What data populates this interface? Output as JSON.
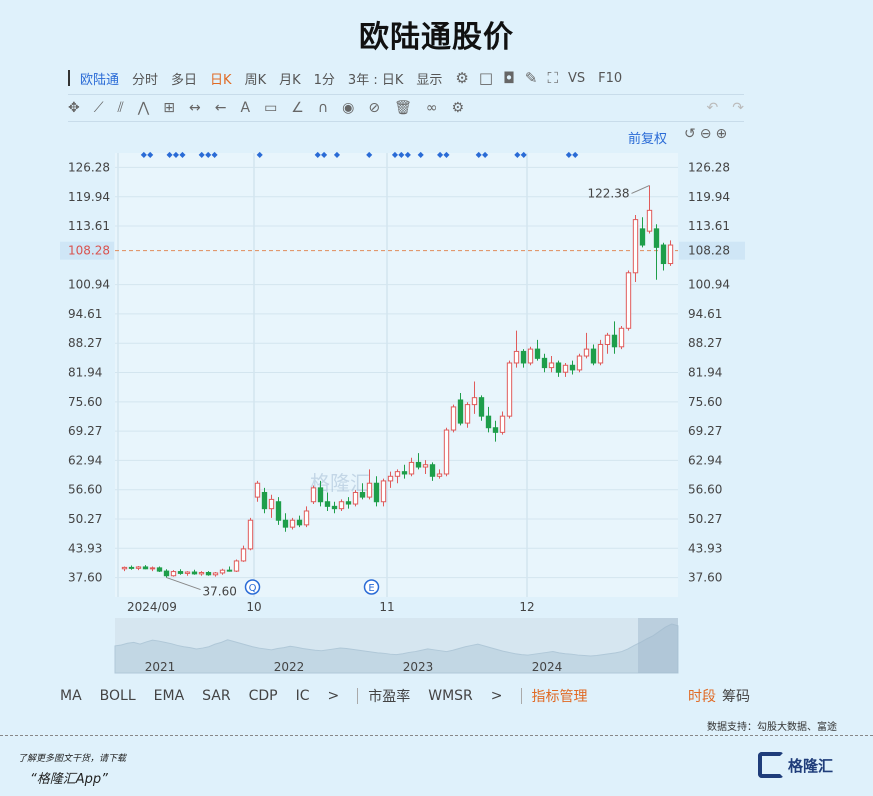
{
  "page": {
    "title": "欧陆通股价"
  },
  "toolbar": {
    "stock_name": "欧陆通",
    "periods": [
      "分时",
      "多日",
      "日K",
      "周K",
      "月K",
      "1分"
    ],
    "active_period": "日K",
    "range": "3年 : 日K",
    "display": "显示",
    "vs": "VS",
    "f10": "F10"
  },
  "adjust_label": "前复权",
  "chart_data": {
    "type": "candlestick",
    "title": "欧陆通股价",
    "y_ticks": [
      126.28,
      119.94,
      113.61,
      108.28,
      100.94,
      94.61,
      88.27,
      81.94,
      75.6,
      69.27,
      62.94,
      56.6,
      50.27,
      43.93,
      37.6
    ],
    "y_tick_labels": [
      "126.28",
      "119.94",
      "113.61",
      "108.28",
      "100.94",
      "94.61",
      "88.27",
      "81.94",
      "75.60",
      "69.27",
      "62.94",
      "56.60",
      "50.27",
      "43.93",
      "37.60"
    ],
    "ylim": [
      33.4,
      129.4
    ],
    "current_price": 108.28,
    "current_price_label": "108.28",
    "max_label": "122.38",
    "min_label": "37.60",
    "x_labels": [
      "2024/09",
      "10",
      "11",
      "12"
    ],
    "event_markers": [
      "Q",
      "E"
    ],
    "candles": [
      [
        39.5,
        40.0,
        39.0,
        39.8
      ],
      [
        39.8,
        40.2,
        39.3,
        39.6
      ],
      [
        39.6,
        40.1,
        39.2,
        39.9
      ],
      [
        39.9,
        40.3,
        39.4,
        39.5
      ],
      [
        39.5,
        40.0,
        39.0,
        39.7
      ],
      [
        39.7,
        40.0,
        38.8,
        39.0
      ],
      [
        39.0,
        39.4,
        37.6,
        38.0
      ],
      [
        38.0,
        39.2,
        37.8,
        38.9
      ],
      [
        38.9,
        39.4,
        38.2,
        38.5
      ],
      [
        38.5,
        39.0,
        38.0,
        38.8
      ],
      [
        38.8,
        39.3,
        38.2,
        38.4
      ],
      [
        38.4,
        39.0,
        38.0,
        38.7
      ],
      [
        38.7,
        39.0,
        38.0,
        38.2
      ],
      [
        38.2,
        38.8,
        37.8,
        38.6
      ],
      [
        38.6,
        39.5,
        38.2,
        39.2
      ],
      [
        39.2,
        40.0,
        38.9,
        39.0
      ],
      [
        39.0,
        41.5,
        38.8,
        41.2
      ],
      [
        41.2,
        44.5,
        41.0,
        43.8
      ],
      [
        43.8,
        50.5,
        43.5,
        50.0
      ],
      [
        55.0,
        58.5,
        54.0,
        58.0
      ],
      [
        56.0,
        57.0,
        51.5,
        52.5
      ],
      [
        52.5,
        55.5,
        50.5,
        54.5
      ],
      [
        54.0,
        55.0,
        49.0,
        50.0
      ],
      [
        50.0,
        51.5,
        47.5,
        48.5
      ],
      [
        48.5,
        50.5,
        48.0,
        50.0
      ],
      [
        50.0,
        51.0,
        48.5,
        49.0
      ],
      [
        49.0,
        53.0,
        48.5,
        52.0
      ],
      [
        54.0,
        57.5,
        53.5,
        57.0
      ],
      [
        57.0,
        58.5,
        53.0,
        54.0
      ],
      [
        54.0,
        56.0,
        52.0,
        53.0
      ],
      [
        53.0,
        54.0,
        51.5,
        52.5
      ],
      [
        52.5,
        54.5,
        52.0,
        54.0
      ],
      [
        54.0,
        55.0,
        52.5,
        53.5
      ],
      [
        53.5,
        56.5,
        53.0,
        56.0
      ],
      [
        56.0,
        58.0,
        54.5,
        55.0
      ],
      [
        55.0,
        61.0,
        54.5,
        58.0
      ],
      [
        58.0,
        59.5,
        53.0,
        54.0
      ],
      [
        54.0,
        59.0,
        53.0,
        58.5
      ],
      [
        58.5,
        60.5,
        57.0,
        59.5
      ],
      [
        59.5,
        61.0,
        58.0,
        60.5
      ],
      [
        60.5,
        62.0,
        59.0,
        60.0
      ],
      [
        60.0,
        63.5,
        59.5,
        62.5
      ],
      [
        62.5,
        64.5,
        61.0,
        61.5
      ],
      [
        61.5,
        63.0,
        60.0,
        62.0
      ],
      [
        62.0,
        62.5,
        58.5,
        59.5
      ],
      [
        59.5,
        61.0,
        59.0,
        60.0
      ],
      [
        60.0,
        70.0,
        59.5,
        69.5
      ],
      [
        69.5,
        75.0,
        69.0,
        74.5
      ],
      [
        76.0,
        77.5,
        70.5,
        71.0
      ],
      [
        71.0,
        75.5,
        70.0,
        75.0
      ],
      [
        75.0,
        80.0,
        73.0,
        76.5
      ],
      [
        76.5,
        77.0,
        71.5,
        72.5
      ],
      [
        72.5,
        74.5,
        69.0,
        70.0
      ],
      [
        70.0,
        71.5,
        67.0,
        69.0
      ],
      [
        69.0,
        73.5,
        68.5,
        72.5
      ],
      [
        72.5,
        84.5,
        72.0,
        84.0
      ],
      [
        84.0,
        91.0,
        83.0,
        86.5
      ],
      [
        86.5,
        87.0,
        83.0,
        84.0
      ],
      [
        84.0,
        87.5,
        83.5,
        87.0
      ],
      [
        87.0,
        89.0,
        84.5,
        85.0
      ],
      [
        85.0,
        86.0,
        82.0,
        83.0
      ],
      [
        83.0,
        85.5,
        82.0,
        84.0
      ],
      [
        84.0,
        84.5,
        81.0,
        82.0
      ],
      [
        82.0,
        84.0,
        81.0,
        83.5
      ],
      [
        83.5,
        84.5,
        81.5,
        82.5
      ],
      [
        82.5,
        86.0,
        82.0,
        85.5
      ],
      [
        85.5,
        90.5,
        85.0,
        87.0
      ],
      [
        87.0,
        88.0,
        83.5,
        84.0
      ],
      [
        84.0,
        89.0,
        83.5,
        88.0
      ],
      [
        88.0,
        90.5,
        86.0,
        90.0
      ],
      [
        90.0,
        93.0,
        86.0,
        87.5
      ],
      [
        87.5,
        92.0,
        87.0,
        91.5
      ],
      [
        91.5,
        104.0,
        91.0,
        103.5
      ],
      [
        103.5,
        116.0,
        101.5,
        115.0
      ],
      [
        113.0,
        115.5,
        109.0,
        109.5
      ],
      [
        112.5,
        122.38,
        112.0,
        117.0
      ],
      [
        113.0,
        114.0,
        102.0,
        109.0
      ],
      [
        109.5,
        110.0,
        104.0,
        105.5
      ],
      [
        105.5,
        110.5,
        105.0,
        109.5
      ]
    ],
    "overview": {
      "years": [
        "2021",
        "2022",
        "2023",
        "2024"
      ],
      "values": [
        62,
        64,
        68,
        70,
        66,
        71,
        75,
        73,
        70,
        67,
        63,
        60,
        58,
        55,
        57,
        60,
        66,
        70,
        76,
        72,
        68,
        64,
        60,
        57,
        55,
        53,
        56,
        58,
        61,
        59,
        56,
        54,
        52,
        51,
        53,
        55,
        57,
        56,
        54,
        52,
        50,
        48,
        46,
        45,
        43,
        42,
        44,
        47,
        49,
        52,
        55,
        53,
        51,
        49,
        52,
        56,
        60,
        63,
        66,
        62,
        58,
        54,
        50,
        47,
        44,
        42,
        41,
        43,
        45,
        47,
        49,
        46,
        44,
        43,
        41,
        40,
        39,
        40,
        42,
        44,
        46,
        49,
        55,
        63,
        70,
        78,
        85,
        95,
        105,
        112,
        108
      ]
    }
  },
  "indicators": {
    "items": [
      "MA",
      "BOLL",
      "EMA",
      "SAR",
      "CDP",
      "IC"
    ],
    "more": ">",
    "items2": [
      "市盈率",
      "WMSR"
    ],
    "more2": ">",
    "manage": "指标管理",
    "right": [
      "时段",
      "筹码"
    ]
  },
  "footer": {
    "source": "数据支持：勾股大数据、富途",
    "promo_line1": "了解更多图文干货，请下载",
    "promo_line2": "“格隆汇App”",
    "logo_text": "格隆汇"
  },
  "colors": {
    "up": "#e05b5b",
    "down": "#1e9e4a",
    "accent": "#2a6bd6",
    "current_line": "#e08a5a"
  }
}
